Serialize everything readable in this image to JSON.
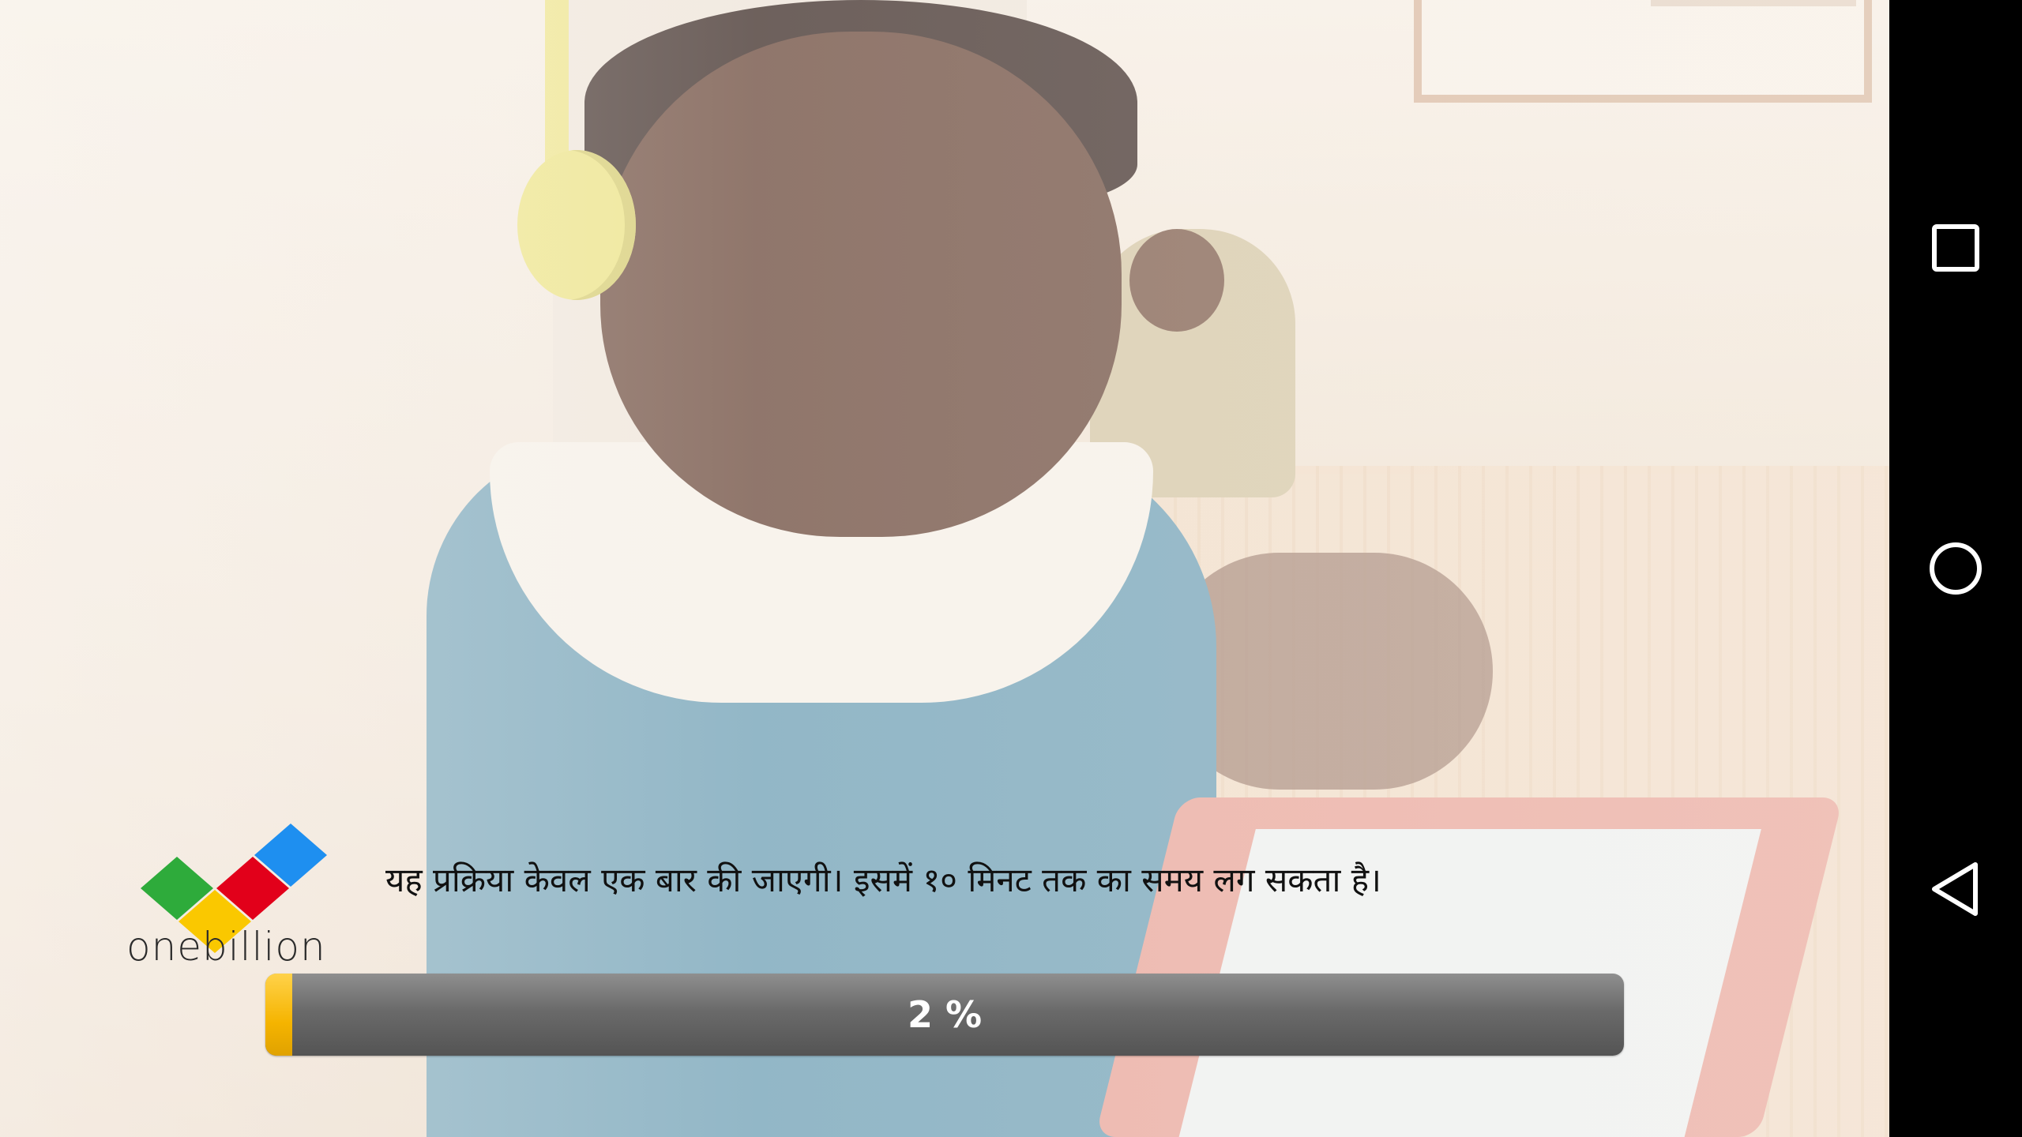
{
  "brand": {
    "name": "onebillion",
    "logo_colors": [
      "#2eab3b",
      "#e2001a",
      "#fac800",
      "#1e8ff0"
    ]
  },
  "loading": {
    "message": "यह प्रक्रिया केवल एक बार की जाएगी। इसमें १० मिनट तक का समय लग सकता है।",
    "progress_percent": 2,
    "progress_label": "2 %"
  },
  "navbar": {
    "buttons": [
      {
        "name": "recents",
        "icon": "square-icon"
      },
      {
        "name": "home",
        "icon": "circle-icon"
      },
      {
        "name": "back",
        "icon": "triangle-back-icon"
      }
    ]
  }
}
